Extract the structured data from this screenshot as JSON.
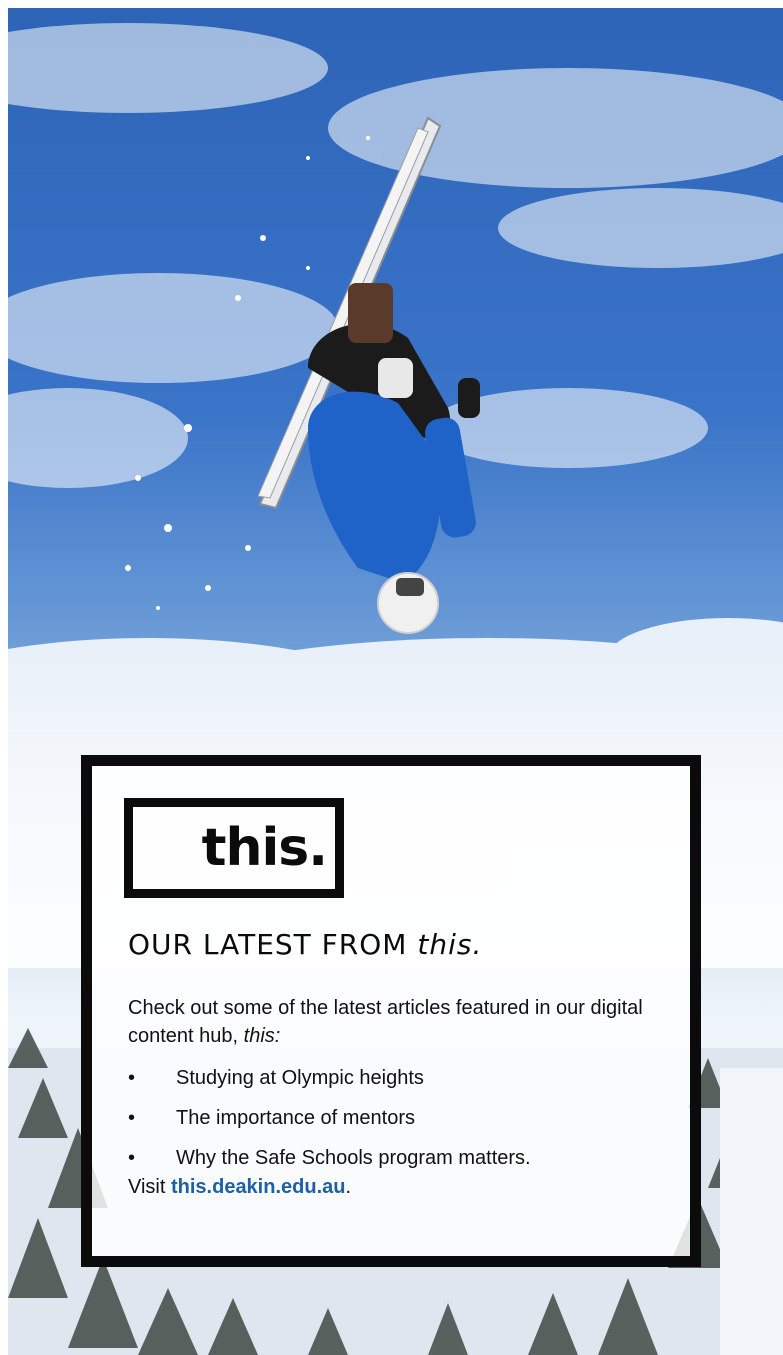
{
  "logo": {
    "text": "this."
  },
  "heading": {
    "prefix": "OUR LATEST FROM",
    "emphasis": "this."
  },
  "intro": {
    "text": "Check out some of the latest articles featured in our digital content hub,",
    "emphasis": "this:"
  },
  "bullet_glyph": "•",
  "articles": [
    "Studying at Olympic heights",
    "The importance of mentors",
    "Why the Safe Schools program matters."
  ],
  "visit": {
    "prefix": "Visit",
    "link": "this.deakin.edu.au",
    "suffix": "."
  },
  "colors": {
    "frame": "#0b0b0b",
    "link": "#1d5fa8",
    "sky": "#2d64b8",
    "skier_jacket": "#1f63c9"
  }
}
